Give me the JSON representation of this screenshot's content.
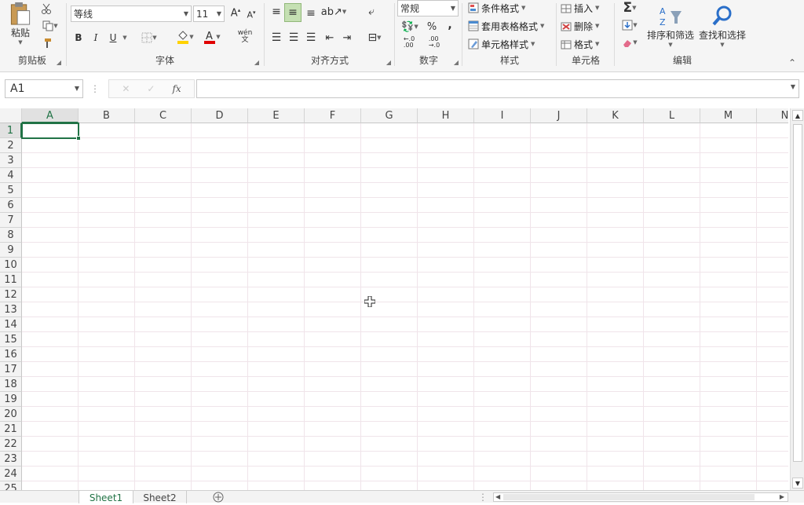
{
  "clipboard": {
    "paste_label": "粘贴",
    "group_label": "剪贴板"
  },
  "font": {
    "name": "等线",
    "size": "11",
    "bold": "B",
    "italic": "I",
    "underline": "U",
    "phonetic": "wén",
    "group_label": "字体"
  },
  "alignment": {
    "group_label": "对齐方式"
  },
  "number": {
    "format": "常规",
    "percent": "%",
    "comma": ",",
    "increase_decimal": "←.0\n.00",
    "decrease_decimal": ".00\n→.0",
    "group_label": "数字"
  },
  "styles": {
    "conditional": "条件格式",
    "table": "套用表格格式",
    "cell": "单元格样式",
    "group_label": "样式"
  },
  "cells": {
    "insert": "插入",
    "delete": "删除",
    "format": "格式",
    "group_label": "单元格"
  },
  "editing": {
    "sort_filter": "排序和筛选",
    "find_select": "查找和选择",
    "group_label": "编辑"
  },
  "formula_bar": {
    "name_box": "A1",
    "fx": "fx",
    "value": ""
  },
  "columns": [
    "A",
    "B",
    "C",
    "D",
    "E",
    "F",
    "G",
    "H",
    "I",
    "J",
    "K",
    "L",
    "M",
    "N"
  ],
  "rows": [
    "1",
    "2",
    "3",
    "4",
    "5",
    "6",
    "7",
    "8",
    "9",
    "10",
    "11",
    "12",
    "13",
    "14",
    "15",
    "16",
    "17",
    "18",
    "19",
    "20",
    "21",
    "22",
    "23",
    "24",
    "25"
  ],
  "sheets": [
    "Sheet1",
    "Sheet2"
  ],
  "colors": {
    "accent": "#217346",
    "font_color": "#e00000",
    "highlight": "#ffd200",
    "gridline": "#f0e4ea"
  },
  "icons": [
    "paste-icon",
    "cut-icon",
    "copy-icon",
    "format-painter-icon",
    "border-icon",
    "fill-color-icon",
    "font-color-icon",
    "autosum-icon",
    "fill-icon",
    "clear-icon",
    "sort-filter-icon",
    "find-icon",
    "add-sheet-icon"
  ]
}
